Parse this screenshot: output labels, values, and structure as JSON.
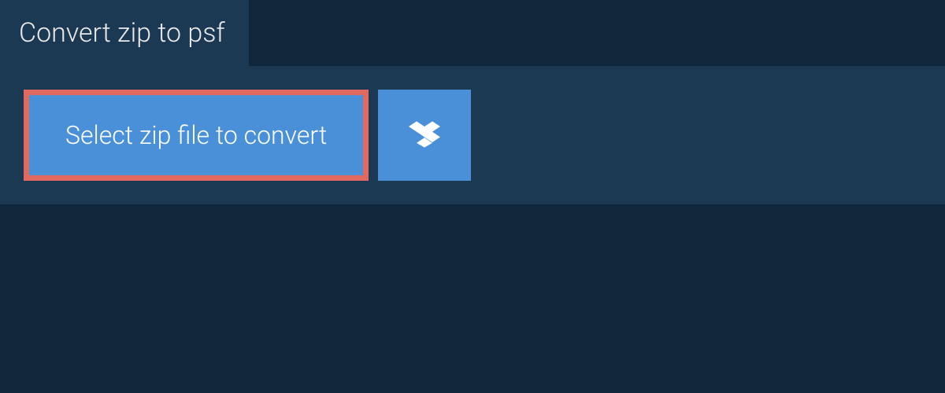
{
  "tab": {
    "title": "Convert zip to psf"
  },
  "actions": {
    "select_label": "Select zip file to convert",
    "dropbox_icon": "dropbox-icon"
  },
  "colors": {
    "background": "#10273c",
    "panel": "#1c3954",
    "button": "#4a90d9",
    "highlight_border": "#e06a5f",
    "text_light": "#e8e8e8",
    "text_white": "#ffffff"
  }
}
